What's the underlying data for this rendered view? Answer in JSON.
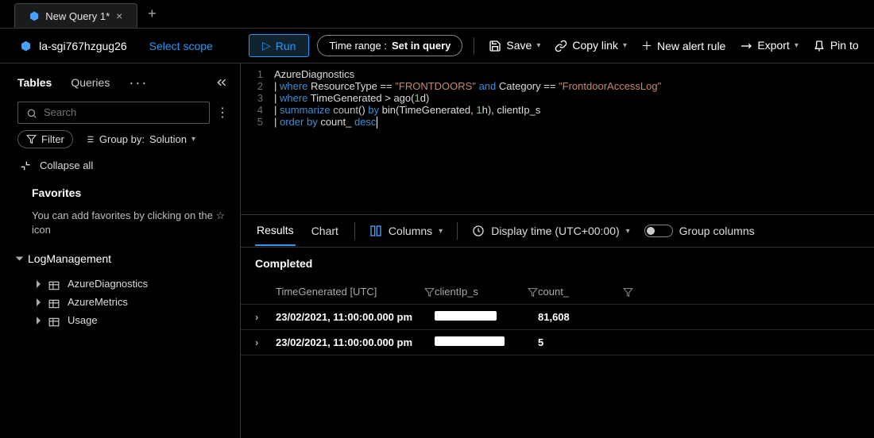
{
  "tabs": {
    "active_label": "New Query 1*"
  },
  "scope": {
    "resource": "la-sgi767hzgug26",
    "select_label": "Select scope"
  },
  "toolbar": {
    "run": "Run",
    "time_range_prefix": "Time range :",
    "time_range_value": "Set in query",
    "save": "Save",
    "copy_link": "Copy link",
    "new_alert": "New alert rule",
    "export": "Export",
    "pin": "Pin to"
  },
  "sidebar": {
    "tabs": {
      "tables": "Tables",
      "queries": "Queries"
    },
    "search_placeholder": "Search",
    "filter": "Filter",
    "group_by_prefix": "Group by:",
    "group_by_value": "Solution",
    "collapse_all": "Collapse all",
    "favorites_title": "Favorites",
    "favorites_hint": "You can add favorites by clicking on the ☆ icon",
    "nodes": {
      "log_management": "LogManagement",
      "items": [
        "AzureDiagnostics",
        "AzureMetrics",
        "Usage"
      ]
    }
  },
  "editor": {
    "lines": [
      {
        "n": "1",
        "tokens": [
          [
            "id",
            "AzureDiagnostics"
          ]
        ]
      },
      {
        "n": "2",
        "tokens": [
          [
            "id",
            "| "
          ],
          [
            "kw",
            "where"
          ],
          [
            "id",
            " ResourceType == "
          ],
          [
            "str",
            "\"FRONTDOORS\""
          ],
          [
            "id",
            " "
          ],
          [
            "kw",
            "and"
          ],
          [
            "id",
            " Category == "
          ],
          [
            "str",
            "\"FrontdoorAccessLog\""
          ]
        ]
      },
      {
        "n": "3",
        "tokens": [
          [
            "id",
            "| "
          ],
          [
            "kw",
            "where"
          ],
          [
            "id",
            " TimeGenerated > ago("
          ],
          [
            "num",
            "1"
          ],
          [
            "id",
            "d)"
          ]
        ]
      },
      {
        "n": "4",
        "tokens": [
          [
            "id",
            "| "
          ],
          [
            "kw",
            "summarize"
          ],
          [
            "id",
            " "
          ],
          [
            "fn",
            "count"
          ],
          [
            "id",
            "() "
          ],
          [
            "kw",
            "by"
          ],
          [
            "id",
            " bin(TimeGenerated, "
          ],
          [
            "num",
            "1"
          ],
          [
            "id",
            "h), clientIp_s"
          ]
        ]
      },
      {
        "n": "5",
        "tokens": [
          [
            "id",
            "| "
          ],
          [
            "kw",
            "order by"
          ],
          [
            "id",
            " count_ "
          ],
          [
            "kw",
            "desc"
          ]
        ],
        "cursor": true
      }
    ]
  },
  "results": {
    "tabs": {
      "results": "Results",
      "chart": "Chart"
    },
    "columns_btn": "Columns",
    "display_time": "Display time (UTC+00:00)",
    "group_cols": "Group columns",
    "status": "Completed",
    "headers": {
      "tg": "TimeGenerated [UTC]",
      "ip": "clientIp_s",
      "cnt": "count_"
    },
    "rows": [
      {
        "tg": "23/02/2021, 11:00:00.000 pm",
        "cnt": "81,608"
      },
      {
        "tg": "23/02/2021, 11:00:00.000 pm",
        "cnt": "5"
      }
    ]
  }
}
